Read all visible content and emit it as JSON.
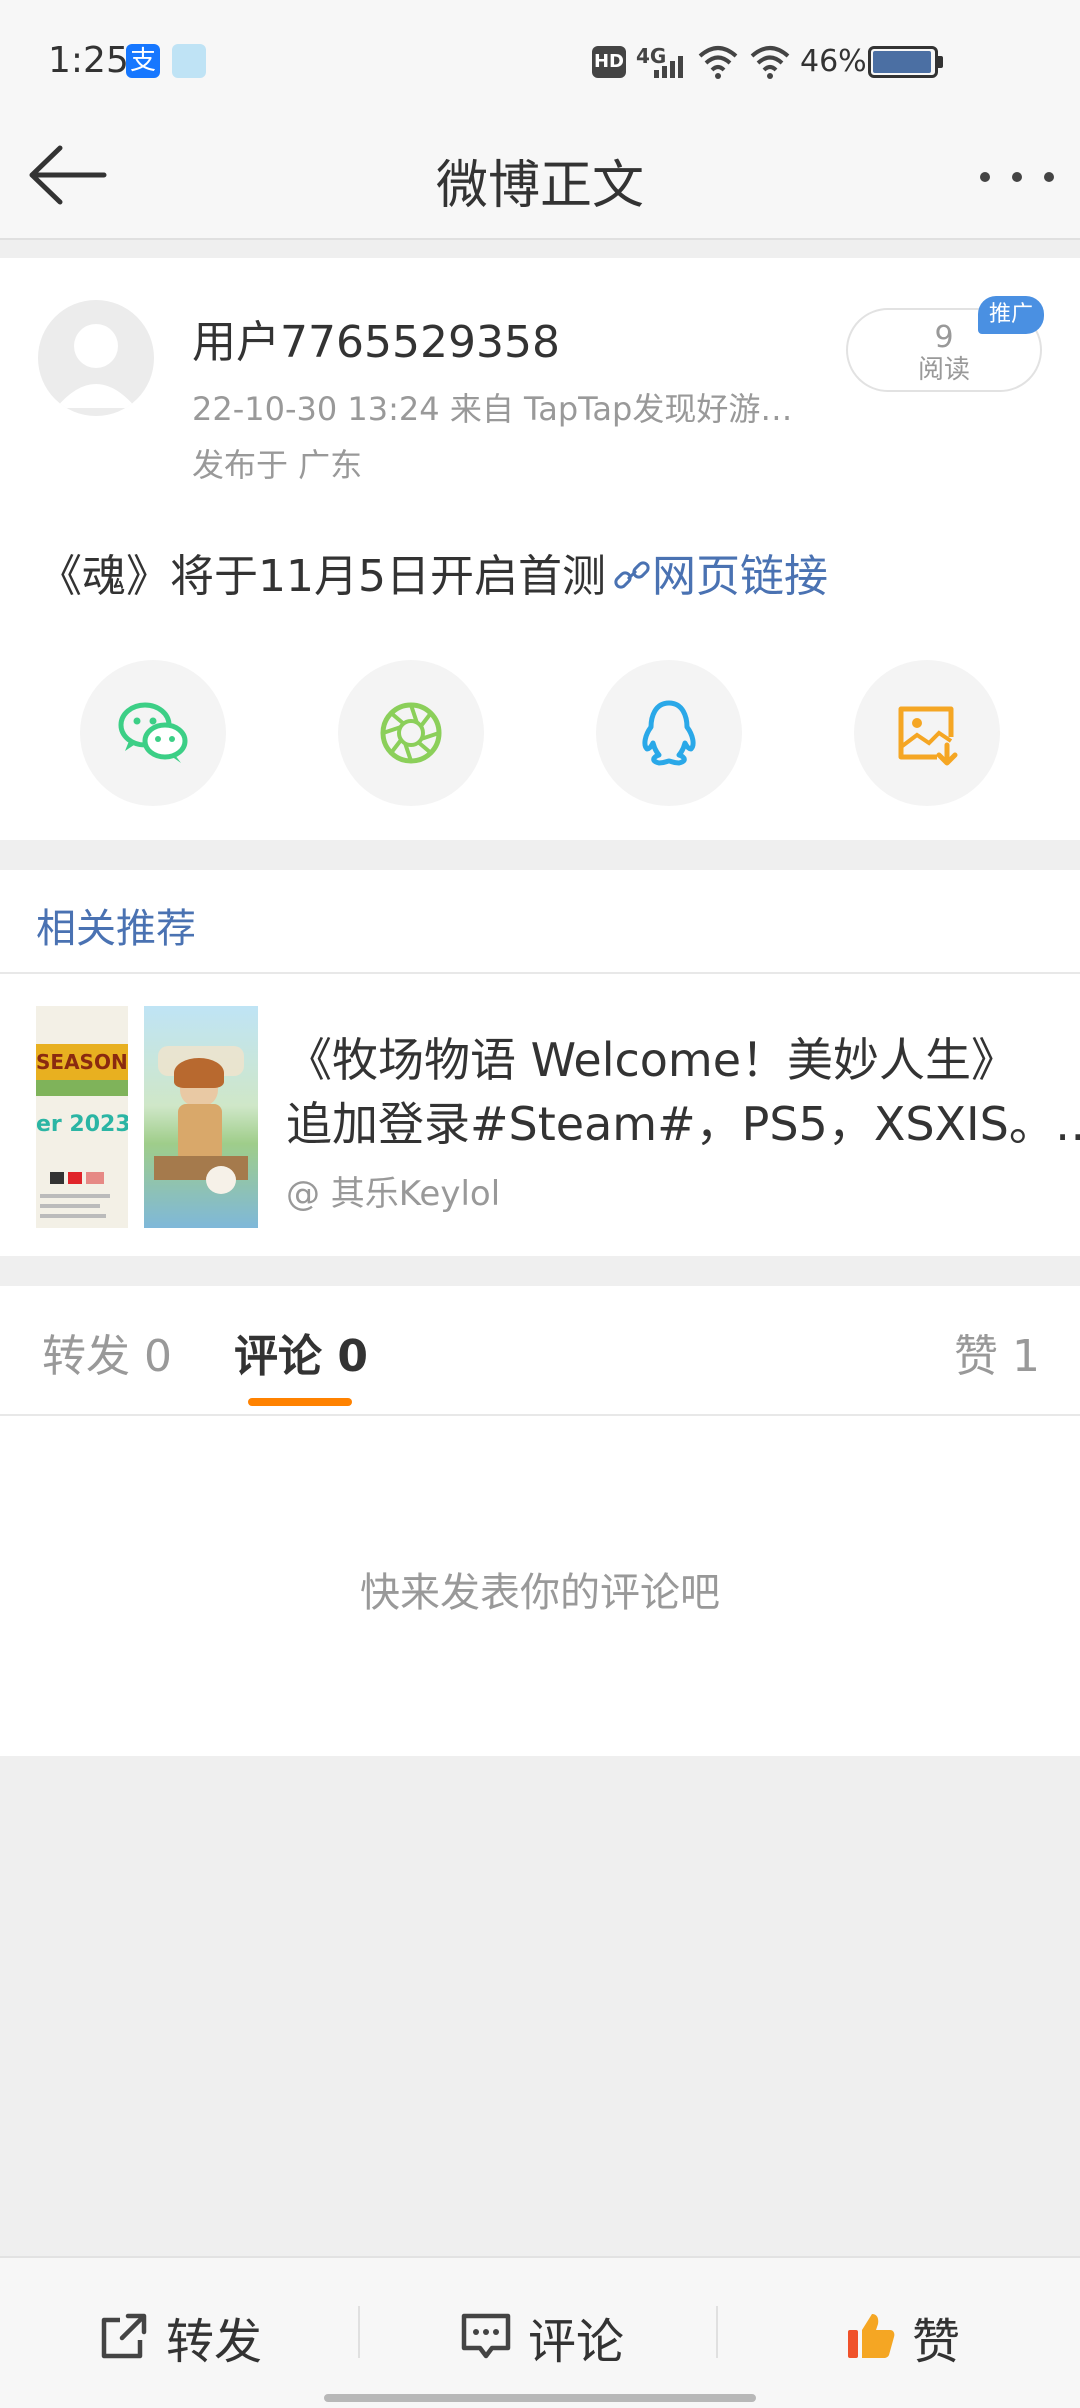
{
  "status_bar": {
    "time": "1:25",
    "app_icon_1": "支",
    "hd": "HD",
    "network": "4G",
    "battery": "46%"
  },
  "nav": {
    "title": "微博正文"
  },
  "post": {
    "username": "用户7765529358",
    "meta": "22-10-30 13:24  来自 TapTap发现好游…",
    "location": "发布于 广东",
    "read_count": "9",
    "read_label": "阅读",
    "promo_tag": "推广",
    "text": "《魂》将于11月5日开启首测",
    "link_text": "网页链接"
  },
  "share_icons": [
    "wechat-icon",
    "moments-icon",
    "qq-icon",
    "save-image-icon"
  ],
  "related": {
    "section_title": "相关推荐",
    "thumb_text_1": "SEASONS",
    "thumb_text_2": "er 2023",
    "title_line1": "《牧场物语 Welcome！美妙人生》",
    "title_line2": "追加登录#Steam#，PS5，XSXIS。…",
    "source": "@ 其乐Keylol"
  },
  "tabs": {
    "repost": "转发 0",
    "comment": "评论 0",
    "like": "赞 1"
  },
  "empty_comments": "快来发表你的评论吧",
  "bottom_bar": {
    "repost": "转发",
    "comment": "评论",
    "like": "赞"
  },
  "colors": {
    "accent_orange": "#ff8200",
    "link_blue": "#4a72b2",
    "wechat_green": "#3ccf86",
    "moments_green": "#8bcf5a",
    "qq_blue": "#2aa8e8",
    "save_orange": "#f5a623",
    "like_red": "#f0522b"
  }
}
